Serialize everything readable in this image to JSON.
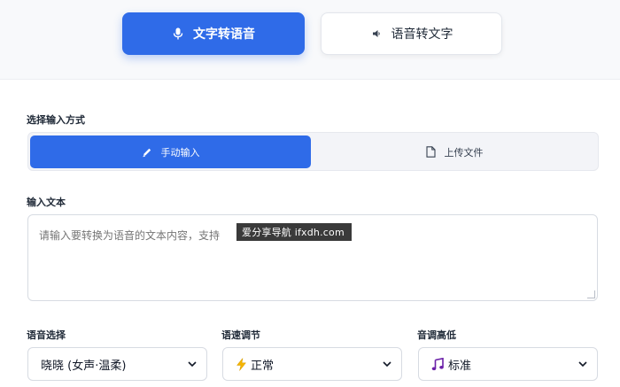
{
  "mode_tabs": {
    "text_to_speech": "文字转语音",
    "speech_to_text": "语音转文字"
  },
  "input_method": {
    "label": "选择输入方式",
    "manual": "手动输入",
    "upload": "上传文件"
  },
  "text_input": {
    "label": "输入文本",
    "placeholder": "请输入要转换为语音的文本内容，支持"
  },
  "watermark": "爱分享导航 ifxdh.com",
  "voice": {
    "label": "语音选择",
    "selected": "晓晓 (女声·温柔)"
  },
  "speed": {
    "label": "语速调节",
    "icon": "lightning-icon",
    "selected": "正常"
  },
  "pitch": {
    "label": "音调高低",
    "icon": "music-note-icon",
    "selected": "标准"
  },
  "colors": {
    "accent": "#2f6be8",
    "border": "#d7dbe2",
    "speed_icon": "#f5b400",
    "pitch_icon": "#6b21a8"
  }
}
